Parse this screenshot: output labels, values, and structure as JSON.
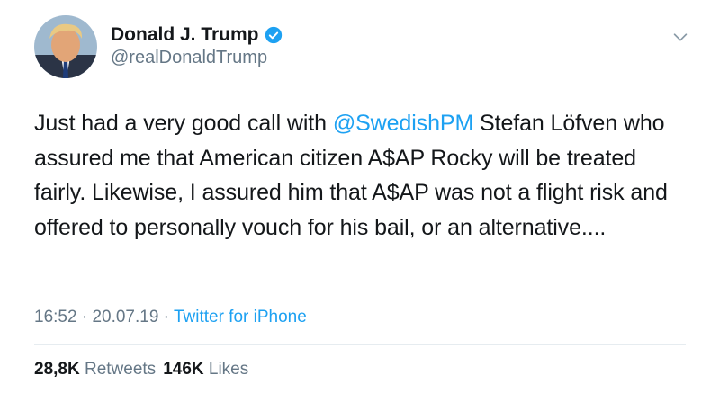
{
  "author": {
    "display_name": "Donald J. Trump",
    "handle": "@realDonaldTrump",
    "verified": true
  },
  "menu": {
    "icon": "chevron-down-icon"
  },
  "tweet": {
    "text_before_mention": "Just had a very good call with ",
    "mention": "@SwedishPM",
    "text_after_mention": " Stefan Löfven who assured me that American citizen A$AP Rocky will be treated fairly. Likewise, I assured him that A$AP was not a flight risk and offered to personally vouch for his bail, or an alternative...."
  },
  "meta": {
    "time": "16:52",
    "sep1": " · ",
    "date": "20.07.19",
    "sep2": " · ",
    "source": "Twitter for iPhone"
  },
  "stats": {
    "retweets_count": "28,8K",
    "retweets_label": "Retweets",
    "likes_count": "146K",
    "likes_label": "Likes"
  },
  "colors": {
    "accent": "#1da1f2",
    "text": "#14171a",
    "secondary": "#657786",
    "divider": "#e6ecf0"
  }
}
